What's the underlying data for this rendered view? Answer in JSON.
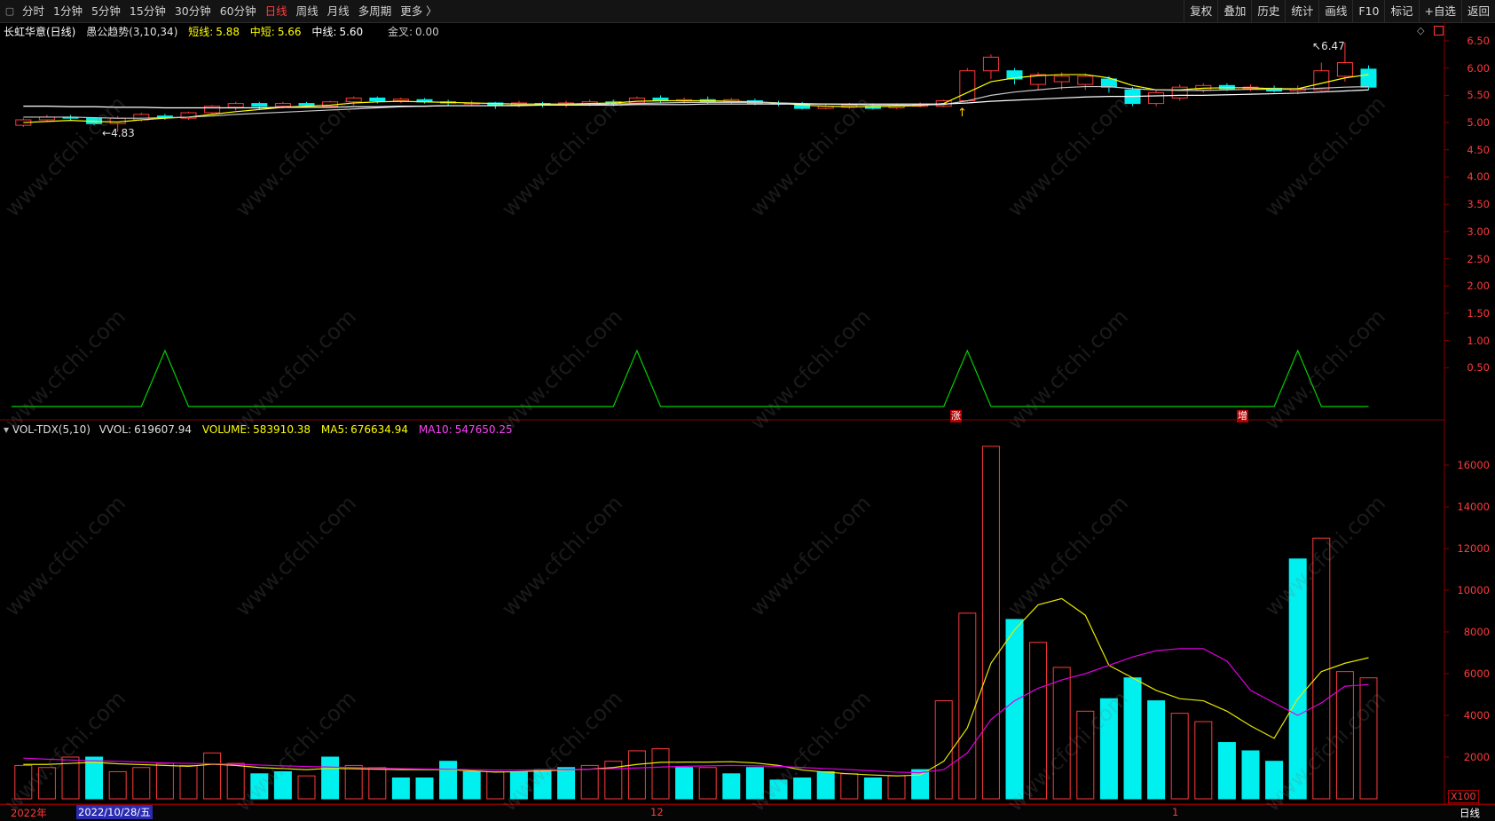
{
  "toolbar": {
    "menu_icon": "▢",
    "timeframes": [
      "分时",
      "1分钟",
      "5分钟",
      "15分钟",
      "30分钟",
      "60分钟",
      "日线",
      "周线",
      "月线",
      "多周期",
      "更多 〉"
    ],
    "active": "日线",
    "right": [
      "复权",
      "叠加",
      "历史",
      "统计",
      "画线",
      "F10",
      "标记",
      "+自选",
      "返回"
    ]
  },
  "main_panel": {
    "stock": "长虹华意(日线)",
    "indicator": "愚公趋势(3,10,34)",
    "short_label": "短线:",
    "short_value": "5.88",
    "mid_short_label": "中短:",
    "mid_short_value": "5.66",
    "mid_label": "中线:",
    "mid_value": "5.60",
    "gold_label": "金叉:",
    "gold_value": "0.00",
    "high_label": "6.47",
    "low_label": "4.83",
    "y_ticks": [
      "6.50",
      "6.00",
      "5.50",
      "5.00",
      "4.50",
      "4.00",
      "3.50",
      "3.00",
      "2.50",
      "2.00",
      "1.50",
      "1.00",
      "0.50"
    ],
    "signal_labels": [
      "涨",
      "增"
    ]
  },
  "vol_panel": {
    "name": "VOL-TDX(5,10)",
    "vvol_label": "VVOL:",
    "vvol_value": "619607.94",
    "volume_label": "VOLUME:",
    "volume_value": "583910.38",
    "ma5_label": "MA5:",
    "ma5_value": "676634.94",
    "ma10_label": "MA10:",
    "ma10_value": "547650.25",
    "y_ticks": [
      "16000",
      "14000",
      "12000",
      "10000",
      "8000",
      "6000",
      "4000",
      "2000"
    ],
    "unit": "X100"
  },
  "x_axis": {
    "labels": [
      "2022年",
      "2022/10/28/五",
      "12",
      "1"
    ],
    "period": "日线"
  },
  "watermark": "www.cfchi.com",
  "colors": {
    "up": "#ff3a3a",
    "down": "#00f0f0",
    "ma_short": "#ffff00",
    "ma_mid": "#ffffff",
    "ma_long": "#c8c8c8",
    "signal": "#00d000",
    "ma5": "#e8e800",
    "ma10": "#e000e0"
  },
  "chart_data": [
    {
      "type": "candlestick",
      "title": "长虹华意(日线)",
      "ylim": [
        0,
        6.7
      ],
      "x_labels": [
        "2022/10/28/五",
        "12",
        "1"
      ],
      "candles": [
        [
          4.95,
          5.05,
          4.92,
          5.08
        ],
        [
          5.05,
          5.1,
          5.02,
          5.14
        ],
        [
          5.1,
          5.08,
          5.05,
          5.14
        ],
        [
          5.08,
          4.98,
          4.95,
          5.1
        ],
        [
          4.98,
          5.08,
          4.83,
          5.12
        ],
        [
          5.05,
          5.15,
          5.02,
          5.18
        ],
        [
          5.12,
          5.1,
          5.05,
          5.16
        ],
        [
          5.08,
          5.18,
          5.05,
          5.2
        ],
        [
          5.18,
          5.3,
          5.15,
          5.32
        ],
        [
          5.28,
          5.35,
          5.22,
          5.38
        ],
        [
          5.35,
          5.3,
          5.25,
          5.38
        ],
        [
          5.3,
          5.35,
          5.26,
          5.38
        ],
        [
          5.35,
          5.32,
          5.28,
          5.38
        ],
        [
          5.3,
          5.38,
          5.27,
          5.4
        ],
        [
          5.38,
          5.45,
          5.32,
          5.48
        ],
        [
          5.45,
          5.4,
          5.35,
          5.48
        ],
        [
          5.4,
          5.43,
          5.36,
          5.46
        ],
        [
          5.42,
          5.38,
          5.35,
          5.45
        ],
        [
          5.38,
          5.36,
          5.3,
          5.42
        ],
        [
          5.36,
          5.36,
          5.3,
          5.4
        ],
        [
          5.36,
          5.32,
          5.25,
          5.38
        ],
        [
          5.32,
          5.36,
          5.28,
          5.4
        ],
        [
          5.35,
          5.32,
          5.28,
          5.38
        ],
        [
          5.32,
          5.36,
          5.28,
          5.4
        ],
        [
          5.33,
          5.38,
          5.3,
          5.42
        ],
        [
          5.38,
          5.35,
          5.3,
          5.42
        ],
        [
          5.36,
          5.45,
          5.33,
          5.48
        ],
        [
          5.45,
          5.4,
          5.36,
          5.5
        ],
        [
          5.4,
          5.42,
          5.35,
          5.46
        ],
        [
          5.42,
          5.38,
          5.35,
          5.48
        ],
        [
          5.38,
          5.42,
          5.35,
          5.45
        ],
        [
          5.4,
          5.36,
          5.32,
          5.44
        ],
        [
          5.36,
          5.34,
          5.3,
          5.4
        ],
        [
          5.34,
          5.26,
          5.24,
          5.38
        ],
        [
          5.26,
          5.3,
          5.24,
          5.34
        ],
        [
          5.28,
          5.32,
          5.25,
          5.36
        ],
        [
          5.3,
          5.26,
          5.24,
          5.35
        ],
        [
          5.27,
          5.32,
          5.25,
          5.35
        ],
        [
          5.3,
          5.33,
          5.28,
          5.37
        ],
        [
          5.3,
          5.4,
          5.28,
          5.42
        ],
        [
          5.4,
          5.95,
          5.38,
          6.0
        ],
        [
          5.95,
          6.2,
          5.8,
          6.25
        ],
        [
          5.95,
          5.8,
          5.7,
          6.0
        ],
        [
          5.7,
          5.88,
          5.6,
          5.92
        ],
        [
          5.75,
          5.85,
          5.6,
          5.92
        ],
        [
          5.7,
          5.85,
          5.6,
          5.9
        ],
        [
          5.8,
          5.65,
          5.55,
          5.85
        ],
        [
          5.6,
          5.35,
          5.3,
          5.65
        ],
        [
          5.35,
          5.55,
          5.3,
          5.6
        ],
        [
          5.45,
          5.65,
          5.4,
          5.7
        ],
        [
          5.6,
          5.68,
          5.55,
          5.72
        ],
        [
          5.68,
          5.62,
          5.58,
          5.72
        ],
        [
          5.62,
          5.65,
          5.58,
          5.7
        ],
        [
          5.63,
          5.58,
          5.55,
          5.68
        ],
        [
          5.58,
          5.62,
          5.52,
          5.68
        ],
        [
          5.6,
          5.95,
          5.58,
          6.1
        ],
        [
          5.85,
          6.1,
          5.75,
          6.47
        ],
        [
          5.98,
          5.65,
          5.6,
          6.05
        ]
      ],
      "series": [
        {
          "name": "短线",
          "values": [
            5.0,
            5.02,
            5.04,
            5.02,
            5.01,
            5.05,
            5.08,
            5.1,
            5.15,
            5.2,
            5.24,
            5.28,
            5.3,
            5.32,
            5.36,
            5.38,
            5.39,
            5.38,
            5.37,
            5.36,
            5.35,
            5.34,
            5.34,
            5.34,
            5.35,
            5.36,
            5.39,
            5.4,
            5.4,
            5.4,
            5.39,
            5.38,
            5.36,
            5.32,
            5.3,
            5.29,
            5.29,
            5.3,
            5.31,
            5.35,
            5.55,
            5.75,
            5.82,
            5.86,
            5.88,
            5.88,
            5.82,
            5.68,
            5.6,
            5.6,
            5.63,
            5.64,
            5.64,
            5.62,
            5.62,
            5.72,
            5.82,
            5.88
          ]
        },
        {
          "name": "中短",
          "values": [
            5.1,
            5.1,
            5.1,
            5.09,
            5.08,
            5.08,
            5.09,
            5.1,
            5.12,
            5.15,
            5.17,
            5.19,
            5.21,
            5.23,
            5.25,
            5.27,
            5.29,
            5.3,
            5.31,
            5.31,
            5.31,
            5.32,
            5.32,
            5.32,
            5.33,
            5.34,
            5.35,
            5.36,
            5.37,
            5.37,
            5.37,
            5.37,
            5.36,
            5.35,
            5.34,
            5.33,
            5.32,
            5.32,
            5.32,
            5.33,
            5.4,
            5.5,
            5.56,
            5.6,
            5.64,
            5.66,
            5.66,
            5.62,
            5.6,
            5.59,
            5.59,
            5.6,
            5.61,
            5.61,
            5.61,
            5.63,
            5.65,
            5.66
          ]
        },
        {
          "name": "中线",
          "values": [
            5.3,
            5.3,
            5.29,
            5.29,
            5.28,
            5.28,
            5.27,
            5.27,
            5.27,
            5.27,
            5.27,
            5.28,
            5.28,
            5.28,
            5.29,
            5.29,
            5.3,
            5.3,
            5.31,
            5.31,
            5.31,
            5.31,
            5.32,
            5.32,
            5.32,
            5.32,
            5.33,
            5.33,
            5.33,
            5.34,
            5.34,
            5.34,
            5.34,
            5.34,
            5.34,
            5.34,
            5.34,
            5.34,
            5.34,
            5.34,
            5.36,
            5.39,
            5.41,
            5.43,
            5.45,
            5.47,
            5.48,
            5.48,
            5.49,
            5.5,
            5.5,
            5.51,
            5.52,
            5.53,
            5.54,
            5.56,
            5.58,
            5.6
          ]
        },
        {
          "name": "金叉",
          "values": [
            0,
            0,
            0,
            0,
            0,
            0,
            1,
            0,
            0,
            0,
            0,
            0,
            0,
            0,
            0,
            0,
            0,
            0,
            0,
            0,
            0,
            0,
            0,
            0,
            0,
            0,
            1,
            0,
            0,
            0,
            0,
            0,
            0,
            0,
            0,
            0,
            0,
            0,
            0,
            0,
            1,
            0,
            0,
            0,
            0,
            0,
            0,
            0,
            0,
            0,
            0,
            0,
            0,
            0,
            1,
            0,
            0,
            0
          ]
        }
      ]
    },
    {
      "type": "bar",
      "title": "VOL-TDX(5,10)",
      "ylim": [
        0,
        17500
      ],
      "unit": "X100",
      "up": [
        true,
        true,
        true,
        false,
        true,
        true,
        true,
        true,
        true,
        true,
        false,
        false,
        true,
        false,
        true,
        true,
        false,
        false,
        false,
        false,
        true,
        false,
        false,
        false,
        true,
        true,
        true,
        true,
        false,
        true,
        false,
        false,
        false,
        false,
        false,
        true,
        false,
        true,
        false,
        true,
        true,
        true,
        false,
        true,
        true,
        true,
        false,
        false,
        false,
        true,
        true,
        false,
        false,
        false,
        false,
        true,
        true,
        true
      ],
      "values": [
        1600,
        1500,
        2000,
        2000,
        1300,
        1500,
        1700,
        1600,
        2200,
        1700,
        1200,
        1300,
        1100,
        2000,
        1600,
        1500,
        1000,
        1000,
        1800,
        1300,
        1300,
        1300,
        1400,
        1500,
        1600,
        1800,
        2300,
        2400,
        1500,
        1500,
        1200,
        1500,
        900,
        1000,
        1300,
        1200,
        1000,
        1100,
        1400,
        4700,
        8900,
        16900,
        8600,
        7500,
        6300,
        4200,
        4800,
        5800,
        4700,
        4100,
        3700,
        2700,
        2300,
        1800,
        11500,
        12500,
        6100,
        5800
      ],
      "series": [
        {
          "name": "MA5",
          "values": [
            1650,
            1650,
            1700,
            1750,
            1680,
            1640,
            1600,
            1560,
            1660,
            1600,
            1500,
            1450,
            1400,
            1460,
            1440,
            1420,
            1400,
            1400,
            1400,
            1340,
            1280,
            1300,
            1340,
            1380,
            1420,
            1500,
            1650,
            1750,
            1760,
            1760,
            1780,
            1720,
            1600,
            1380,
            1280,
            1200,
            1140,
            1100,
            1140,
            1800,
            3400,
            6500,
            8100,
            9300,
            9600,
            8800,
            6400,
            5800,
            5200,
            4800,
            4700,
            4200,
            3500,
            2900,
            4800,
            6100,
            6500,
            6766
          ]
        },
        {
          "name": "MA10",
          "values": [
            1950,
            1900,
            1860,
            1820,
            1800,
            1760,
            1720,
            1700,
            1680,
            1660,
            1620,
            1580,
            1550,
            1520,
            1500,
            1480,
            1450,
            1430,
            1420,
            1400,
            1380,
            1380,
            1390,
            1400,
            1420,
            1440,
            1480,
            1520,
            1560,
            1580,
            1600,
            1580,
            1560,
            1500,
            1450,
            1400,
            1340,
            1280,
            1250,
            1400,
            2200,
            3800,
            4700,
            5300,
            5700,
            6000,
            6400,
            6800,
            7100,
            7200,
            7200,
            6600,
            5200,
            4600,
            4000,
            4600,
            5400,
            5476
          ]
        }
      ]
    }
  ]
}
